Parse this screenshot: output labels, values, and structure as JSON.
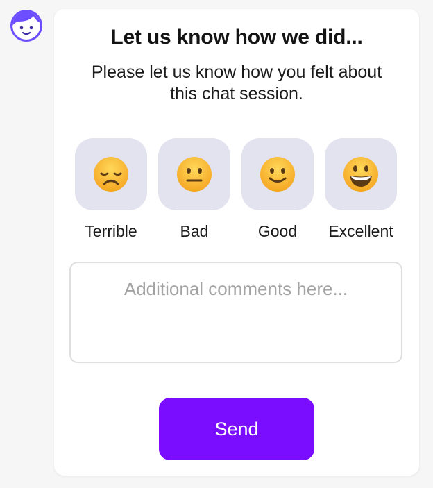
{
  "header": {
    "avatar_icon": "bot-face-icon"
  },
  "feedback": {
    "title": "Let us know how we did...",
    "subtitle": "Please let us know how you felt about this chat session.",
    "ratings": [
      {
        "label": "Terrible",
        "icon": "disappointed-face-icon"
      },
      {
        "label": "Bad",
        "icon": "neutral-face-icon"
      },
      {
        "label": "Good",
        "icon": "slightly-smiling-face-icon"
      },
      {
        "label": "Excellent",
        "icon": "grinning-face-icon"
      }
    ],
    "comments_placeholder": "Additional comments here...",
    "send_label": "Send"
  },
  "colors": {
    "accent": "#7a0cff",
    "tile_background": "#e3e2ef",
    "avatar": "#6c4dff"
  }
}
